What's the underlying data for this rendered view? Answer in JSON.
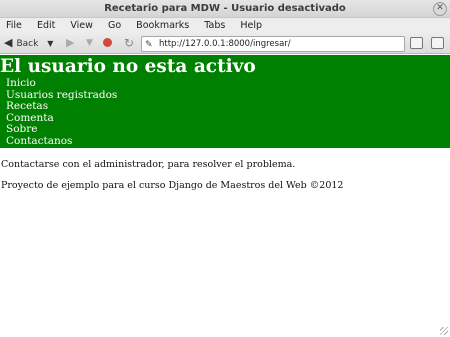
{
  "window": {
    "title": "Recetario para MDW - Usuario desactivado",
    "close_glyph": "✕"
  },
  "menu": {
    "items": [
      "File",
      "Edit",
      "View",
      "Go",
      "Bookmarks",
      "Tabs",
      "Help"
    ]
  },
  "toolbar": {
    "back_label": "Back",
    "url": "http://127.0.0.1:8000/ingresar/"
  },
  "page": {
    "heading": "El usuario no esta activo",
    "nav": [
      "Inicio",
      "Usuarios registrados",
      "Recetas",
      "Comenta",
      "Sobre",
      "Contactanos"
    ],
    "message": "Contactarse con el administrador, para resolver el problema.",
    "footer": "Proyecto de ejemplo para el curso Django de Maestros del Web ©2012"
  },
  "colors": {
    "header_bg": "#008000",
    "header_text": "#ffffff"
  },
  "icons": {
    "back": "back-arrow-icon",
    "forward": "forward-arrow-icon",
    "stop": "stop-icon",
    "reload": "reload-icon",
    "favicon": "page-favicon-icon"
  }
}
